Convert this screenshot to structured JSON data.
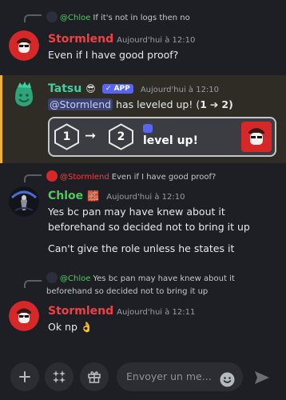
{
  "messages": {
    "m1": {
      "reply_author": "@Chloe",
      "reply_text": "If it's not in logs then no",
      "author": "Stormlend",
      "author_color": "#f23f43",
      "timestamp": "Aujourd'hui à 12:10",
      "text": "Even if I have good proof?"
    },
    "m2": {
      "author": "Tatsu",
      "author_emoji": "😎",
      "author_color": "#3dcfa2",
      "badge": "✓ APP",
      "timestamp": "Aujourd'hui à 12:10",
      "mention": "@Stormlend",
      "text_before": "has leveled up! (",
      "from_level": "1",
      "arrow": "➔",
      "to_level": "2",
      "text_after": ")",
      "card": {
        "from_level": "1",
        "arrow": "➞",
        "to_level": "2",
        "label": "level up!"
      }
    },
    "m3": {
      "reply_author": "@Stormlend",
      "reply_text": "Even if I have good proof?",
      "author": "Chloe",
      "author_emoji": "🧱",
      "author_color": "#4ec95e",
      "timestamp": "Aujourd'hui à 12:10",
      "text": "Yes bc pan may have knew about it beforehand so decided not to bring it up",
      "text2": "Can't give the role unless he states it"
    },
    "m4": {
      "reply_author": "@Chloe",
      "reply_text": "Yes bc pan may have knew about it beforehand so decided not to bring it up",
      "author": "Stormlend",
      "author_color": "#f23f43",
      "timestamp": "Aujourd'hui à 12:11",
      "text": "Ok np",
      "text_emoji": "👌"
    }
  },
  "composer": {
    "placeholder": "Envoyer un me...",
    "add_icon": "plus-icon",
    "apps_icon": "apps-icon",
    "gift_icon": "gift-icon",
    "emoji_icon": "emoji-icon",
    "send_icon": "send-icon"
  },
  "colors": {
    "background": "#1e1f24",
    "highlight": "#2f2c26",
    "highlight_bar": "#f0b232",
    "mention_bg": "#3c4270",
    "badge_bg": "#5865f2"
  }
}
